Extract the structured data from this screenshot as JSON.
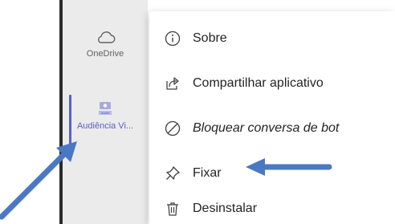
{
  "rail": {
    "onedrive_label": "OneDrive",
    "audiencia_label": "Audiência Vi...",
    "audiencia_icon_text": "audin",
    "more_label": "..."
  },
  "menu": {
    "items": [
      {
        "label": "Sobre",
        "icon": "info-icon"
      },
      {
        "label": "Compartilhar aplicativo",
        "icon": "share-icon"
      },
      {
        "label": "Bloquear conversa de bot",
        "icon": "block-icon"
      },
      {
        "label": "Fixar",
        "icon": "pin-icon"
      },
      {
        "label": "Desinstalar",
        "icon": "trash-icon"
      }
    ]
  },
  "colors": {
    "accent": "#5b5fc7",
    "annotation_arrow": "#4a78c4",
    "rail_bg": "#ebebeb",
    "menu_text": "#242424"
  }
}
